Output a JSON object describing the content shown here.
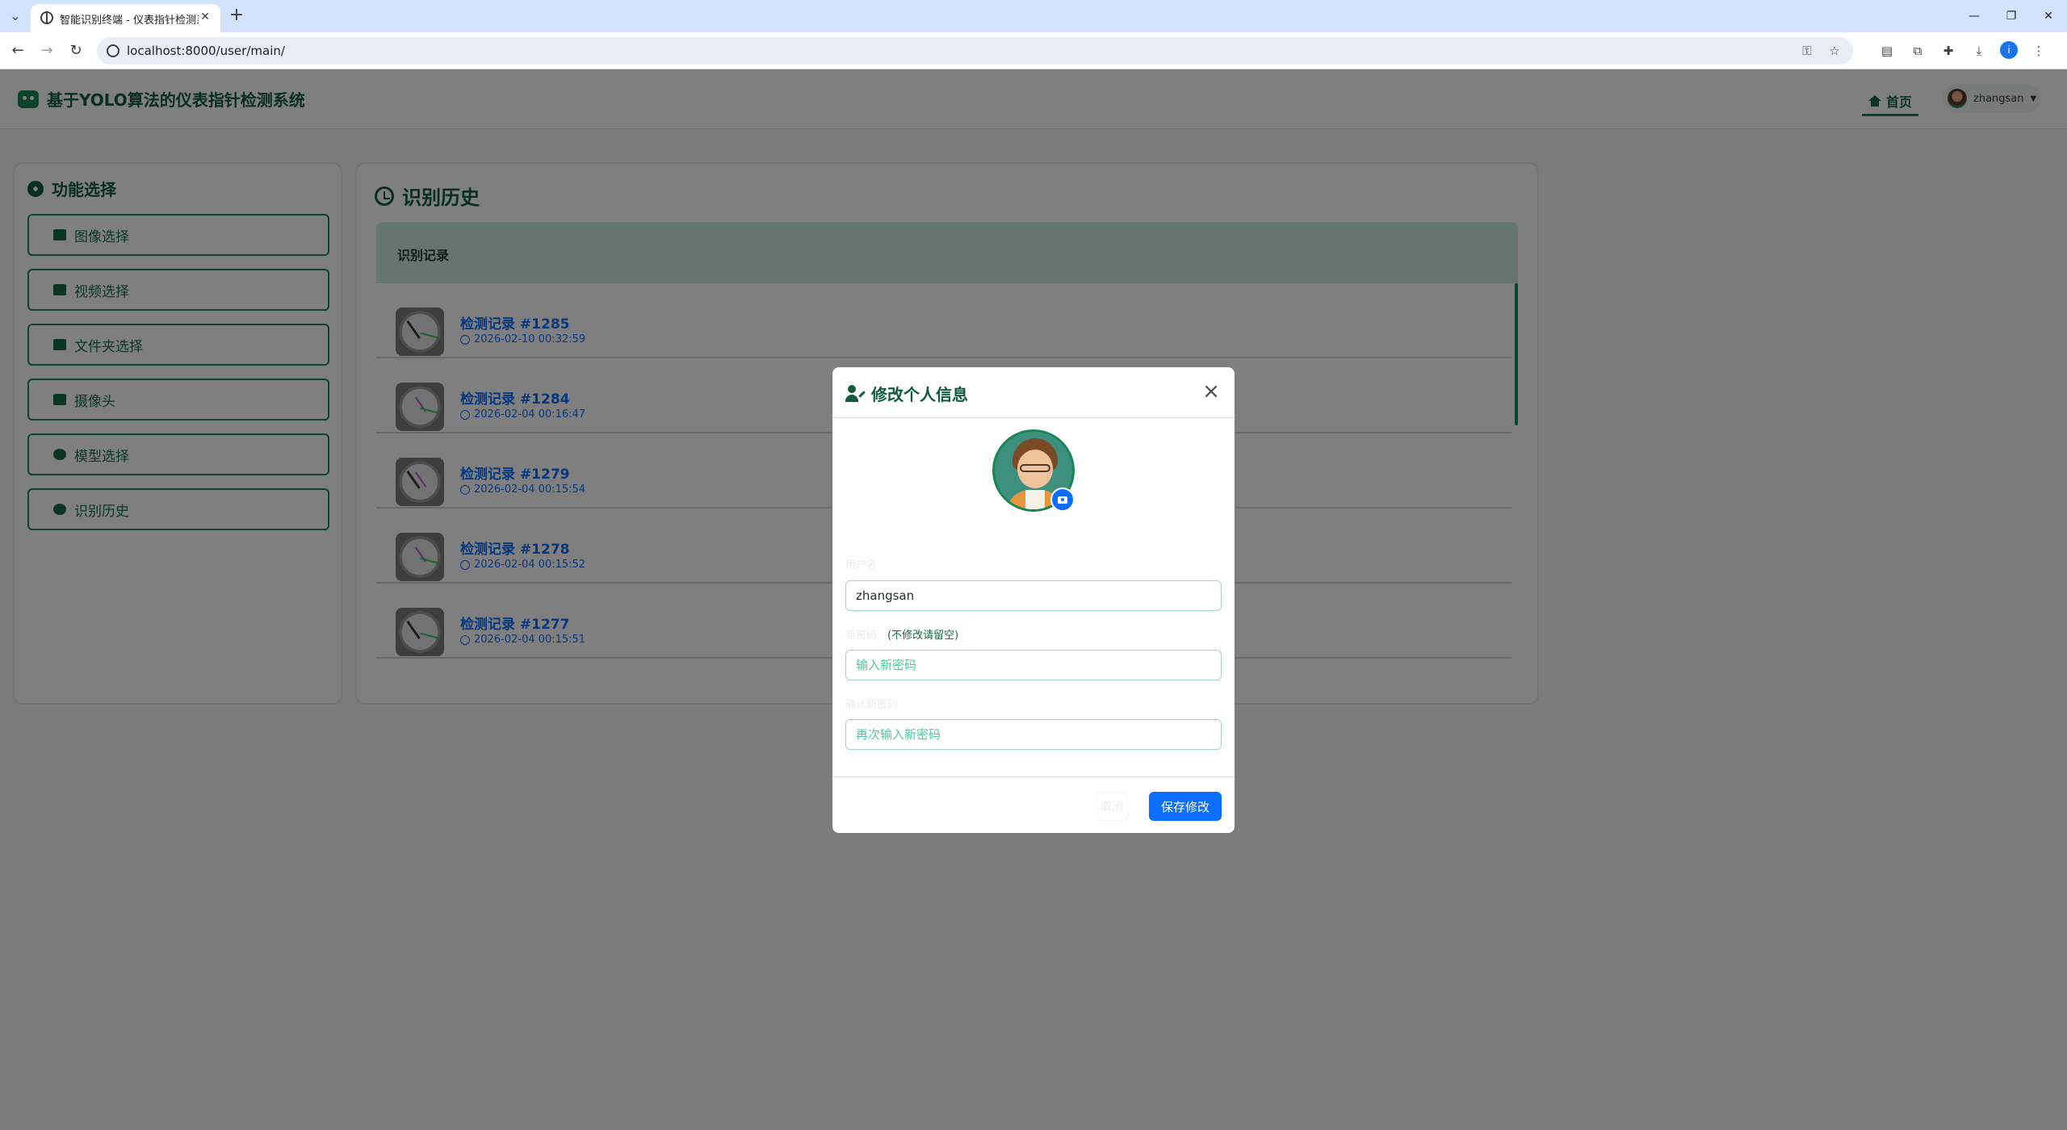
{
  "browser": {
    "tab_title": "智能识别终端 - 仪表指针检测系统",
    "url": "localhost:8000/user/main/"
  },
  "header": {
    "brand": "基于YOLO算法的仪表指针检测系统",
    "nav_home": "首页",
    "username": "zhangsan"
  },
  "sidebar": {
    "title": "功能选择",
    "items": [
      {
        "label": "图像选择",
        "icon": "image-icon"
      },
      {
        "label": "视频选择",
        "icon": "video-icon"
      },
      {
        "label": "文件夹选择",
        "icon": "folder-icon"
      },
      {
        "label": "摄像头",
        "icon": "camera-icon"
      },
      {
        "label": "模型选择",
        "icon": "brain-icon"
      },
      {
        "label": "识别历史",
        "icon": "history-icon"
      }
    ]
  },
  "history": {
    "title": "识别历史",
    "header": "识别记录",
    "records": [
      {
        "title": "检测记录 #1285",
        "time": "2026-02-10 00:32:59"
      },
      {
        "title": "检测记录 #1284",
        "time": "2026-02-04 00:16:47"
      },
      {
        "title": "检测记录 #1279",
        "time": "2026-02-04 00:15:54"
      },
      {
        "title": "检测记录 #1278",
        "time": "2026-02-04 00:15:52"
      },
      {
        "title": "检测记录 #1277",
        "time": "2026-02-04 00:15:51"
      }
    ]
  },
  "modal": {
    "title": "修改个人信息",
    "username_label": "用户名",
    "username_value": "zhangsan",
    "password_label": "新密码",
    "password_hint": "(不修改请留空)",
    "password_placeholder": "输入新密码",
    "confirm_label": "确认新密码",
    "confirm_placeholder": "再次输入新密码",
    "cancel_label": "取消",
    "save_label": "保存修改"
  },
  "colors": {
    "brand_green": "#198754",
    "primary_blue": "#0d6efd"
  }
}
